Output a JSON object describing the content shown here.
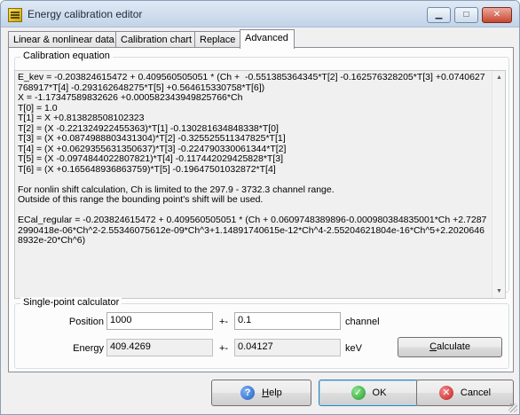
{
  "window": {
    "title": "Energy calibration editor",
    "controls": {
      "minimize": "▁",
      "maximize": "□",
      "close": "✕"
    }
  },
  "tabs": [
    {
      "label": "Linear & nonlinear data"
    },
    {
      "label": "Calibration chart"
    },
    {
      "label": "Replace"
    },
    {
      "label": "Advanced"
    }
  ],
  "active_tab": "Advanced",
  "calibration_equation": {
    "group_label": "Calibration equation",
    "text": "E_kev = -0.203824615472 + 0.409560505051 * (Ch +  -0.551385364345*T[2] -0.162576328205*T[3] +0.0740627768917*T[4] -0.293162648275*T[5] +0.564615330758*T[6])\nX = -1.17347589832626 +0.000582343949825766*Ch\nT[0] = 1.0\nT[1] = X +0.813828508102323\nT[2] = (X -0.221324922455363)*T[1] -0.130281634848338*T[0]\nT[3] = (X +0.0874988803431304)*T[2] -0.325525511347825*T[1]\nT[4] = (X +0.0629355631350637)*T[3] -0.224790330061344*T[2]\nT[5] = (X -0.0974844022807821)*T[4] -0.117442029425828*T[3]\nT[6] = (X +0.165648936863759)*T[5] -0.19647501032872*T[4]\n\nFor nonlin shift calculation, Ch is limited to the 297.9 - 3732.3 channel range.\nOutside of this range the bounding point's shift will be used.\n\nECal_regular = -0.203824615472 + 0.409560505051 * (Ch + 0.0609748389896-0.000980384835001*Ch +2.72872990418e-06*Ch^2-2.55346075612e-09*Ch^3+1.14891740615e-12*Ch^4-2.55204621804e-16*Ch^5+2.20206468932e-20*Ch^6)"
  },
  "calculator": {
    "group_label": "Single-point calculator",
    "position_label": "Position",
    "position_value": "1000",
    "pm1": "+-",
    "position_unc": "0.1",
    "channel_label": "channel",
    "energy_label": "Energy",
    "energy_value": "409.4269",
    "pm2": "+-",
    "energy_unc": "0.04127",
    "kev_label": "keV",
    "calculate_label": "Calculate",
    "calculate_underline": "C",
    "calculate_rest": "alculate"
  },
  "buttons": {
    "help": {
      "u": "H",
      "rest": "elp"
    },
    "ok": "OK",
    "cancel": "Cancel"
  }
}
